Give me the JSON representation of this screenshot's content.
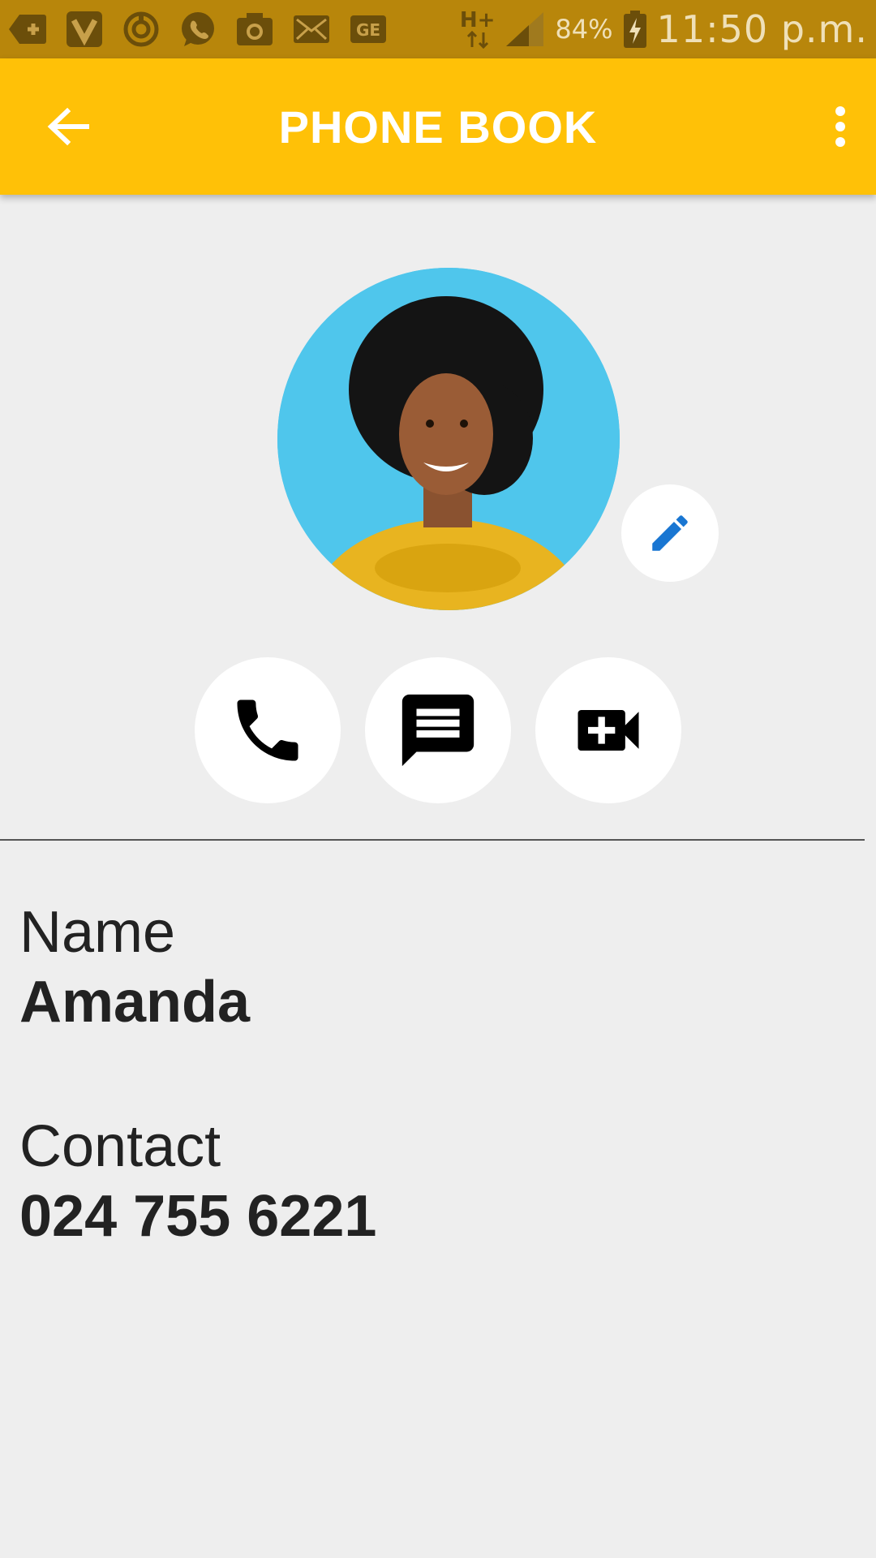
{
  "status_bar": {
    "network": "H+",
    "battery": "84%",
    "time": "11:50 p.m."
  },
  "app_bar": {
    "title": "PHONE BOOK"
  },
  "contact": {
    "name_label": "Name",
    "name_value": "Amanda",
    "contact_label": "Contact",
    "contact_value": "024 755 6221"
  },
  "colors": {
    "status_bar": "#b8860b",
    "app_bar": "#ffc107",
    "background": "#eeeeee",
    "edit_icon": "#1976d2"
  },
  "icons": {
    "back": "arrow-left-icon",
    "menu": "more-vert-icon",
    "edit": "pencil-icon",
    "call": "phone-icon",
    "message": "message-icon",
    "video": "video-call-icon"
  }
}
